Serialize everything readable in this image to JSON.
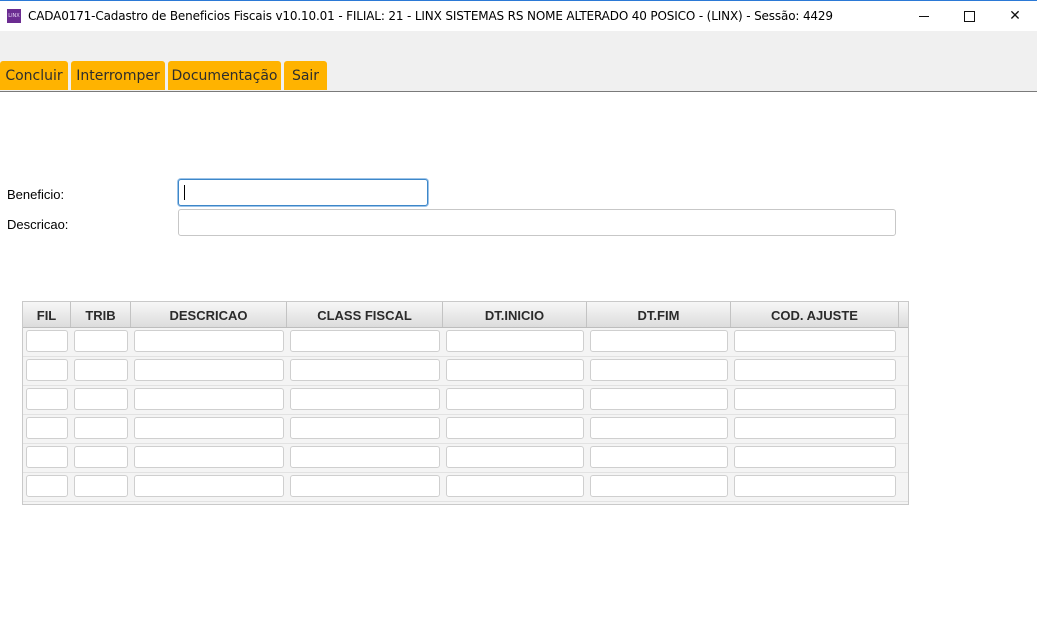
{
  "window": {
    "title": "CADA0171-Cadastro de Beneficios Fiscais v10.10.01   - FILIAL: 21 - LINX SISTEMAS RS NOME ALTERADO 40 POSICO - (LINX) - Sessão: 4429",
    "icon": "linx-app-icon",
    "icon_text": "LINX",
    "controls": {
      "minimize": "minimize-icon",
      "maximize": "maximize-icon",
      "close": "close-icon"
    }
  },
  "toolbar": {
    "buttons": [
      "Concluir",
      "Interromper",
      "Documentação",
      "Sair"
    ],
    "accent": "#ffb300"
  },
  "form": {
    "beneficio": {
      "label": "Beneficio:",
      "value": ""
    },
    "descricao": {
      "label": "Descricao:",
      "value": ""
    }
  },
  "grid": {
    "columns": [
      "FIL",
      "TRIB",
      "DESCRICAO",
      "CLASS FISCAL",
      "DT.INICIO",
      "DT.FIM",
      "COD. AJUSTE"
    ],
    "rows": [
      [
        "",
        "",
        "",
        "",
        "",
        "",
        ""
      ],
      [
        "",
        "",
        "",
        "",
        "",
        "",
        ""
      ],
      [
        "",
        "",
        "",
        "",
        "",
        "",
        ""
      ],
      [
        "",
        "",
        "",
        "",
        "",
        "",
        ""
      ],
      [
        "",
        "",
        "",
        "",
        "",
        "",
        ""
      ],
      [
        "",
        "",
        "",
        "",
        "",
        "",
        ""
      ]
    ]
  }
}
